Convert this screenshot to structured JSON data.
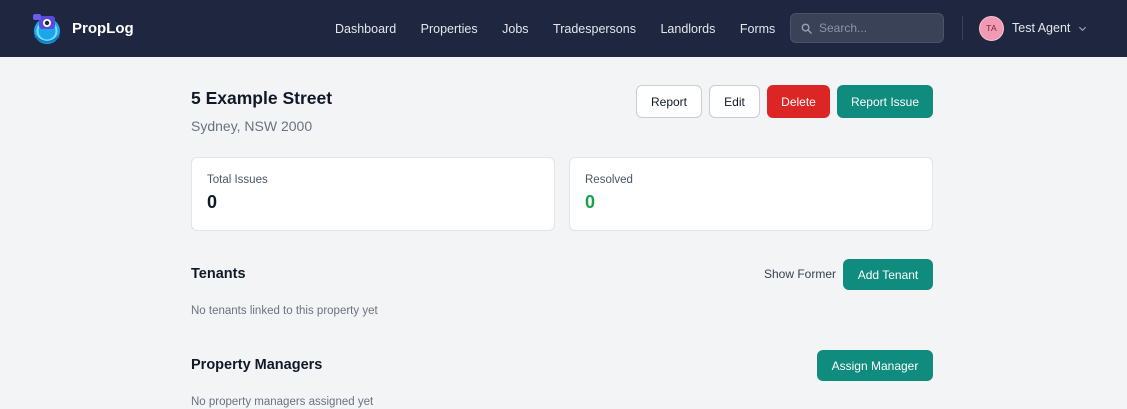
{
  "brand": {
    "name": "PropLog",
    "logo_icon": "proplog-logo-icon"
  },
  "nav": {
    "links": [
      "Dashboard",
      "Properties",
      "Jobs",
      "Tradespersons",
      "Landlords",
      "Forms"
    ],
    "search_placeholder": "Search...",
    "user": {
      "initials": "TA",
      "name": "Test Agent"
    }
  },
  "property": {
    "title": "5 Example Street",
    "address": "Sydney, NSW 2000",
    "actions": {
      "report": "Report",
      "edit": "Edit",
      "delete": "Delete",
      "report_issue": "Report Issue"
    }
  },
  "stats": {
    "total_issues": {
      "label": "Total Issues",
      "value": "0"
    },
    "resolved": {
      "label": "Resolved",
      "value": "0"
    }
  },
  "tenants": {
    "title": "Tenants",
    "show_former": "Show Former",
    "add_button": "Add Tenant",
    "empty": "No tenants linked to this property yet"
  },
  "managers": {
    "title": "Property Managers",
    "assign_button": "Assign Manager",
    "empty": "No property managers assigned yet"
  },
  "colors": {
    "navbar_bg": "#1e2640",
    "accent_teal": "#0f8c7d",
    "danger_red": "#dc2626",
    "resolved_green": "#16a34a",
    "page_bg": "#f3f4f6"
  }
}
